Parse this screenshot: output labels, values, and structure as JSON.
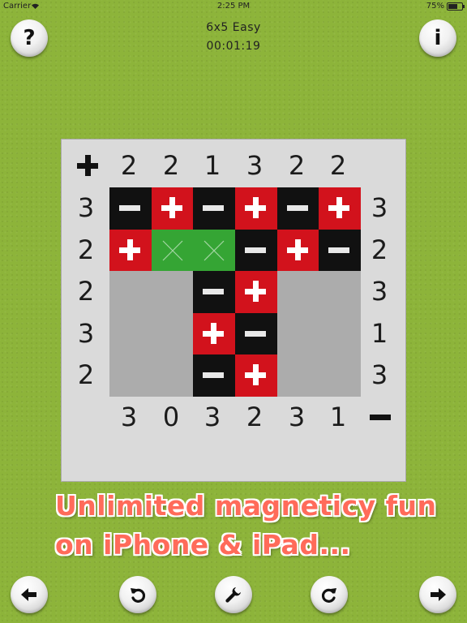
{
  "status_bar": {
    "carrier": "Carrier",
    "time": "2:25 PM",
    "battery": "75%"
  },
  "header": {
    "title": "6x5 Easy",
    "timer": "00:01:19"
  },
  "top_buttons": {
    "help_label": "?",
    "info_label": "i"
  },
  "board": {
    "plus_symbol": "+",
    "minus_symbol": "−",
    "col_plus": [
      "2",
      "2",
      "1",
      "3",
      "2",
      "2"
    ],
    "row_plus": [
      "3",
      "2",
      "2",
      "3",
      "2"
    ],
    "row_minus": [
      "3",
      "2",
      "3",
      "1",
      "3"
    ],
    "col_minus": [
      "3",
      "0",
      "3",
      "2",
      "3",
      "1"
    ],
    "grid": [
      [
        "minus",
        "plus",
        "minus",
        "plus",
        "minus",
        "plus"
      ],
      [
        "plus",
        "empty-marked",
        "empty-marked",
        "minus",
        "plus",
        "minus"
      ],
      [
        "unknown",
        "unknown",
        "minus",
        "plus",
        "unknown",
        "unknown"
      ],
      [
        "unknown",
        "unknown",
        "plus",
        "minus",
        "unknown",
        "unknown"
      ],
      [
        "unknown",
        "unknown",
        "minus",
        "plus",
        "unknown",
        "unknown"
      ]
    ]
  },
  "promo": {
    "line1": "Unlimited magneticy fun",
    "line2": "on iPhone & iPad..."
  },
  "bottom_toolbar": [
    "arrow-left-icon",
    "undo-icon",
    "wrench-icon",
    "redo-icon",
    "arrow-right-icon"
  ],
  "colors": {
    "background": "#8db43a",
    "plus": "#d2121c",
    "minus": "#111111",
    "empty": "#35a534",
    "unknown": "#acacac",
    "promo": "#ff6b5a"
  }
}
